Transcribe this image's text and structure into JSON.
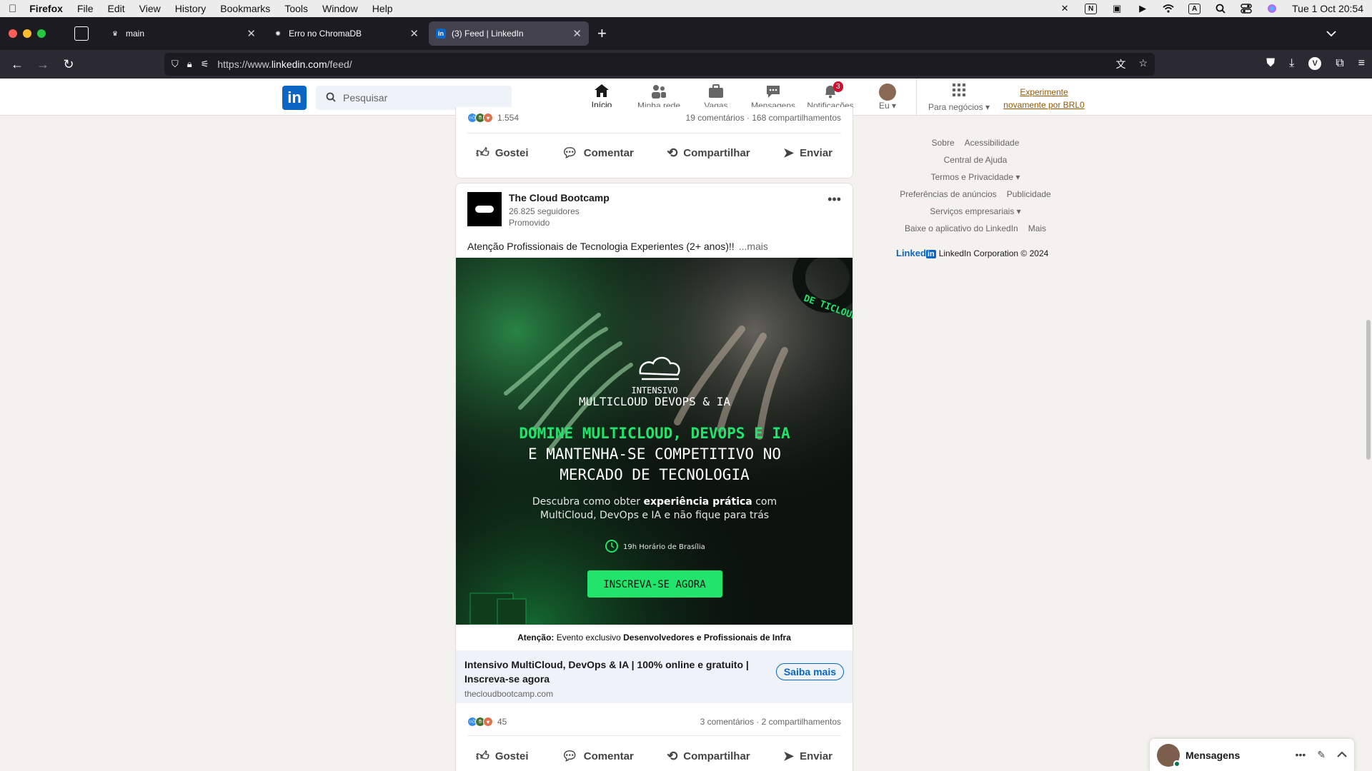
{
  "menubar": {
    "app": "Firefox",
    "items": [
      "File",
      "Edit",
      "View",
      "History",
      "Bookmarks",
      "Tools",
      "Window",
      "Help"
    ],
    "clock": "Tue 1 Oct  20:54"
  },
  "browser": {
    "tabs": [
      {
        "title": "main",
        "active": false
      },
      {
        "title": "Erro no ChromaDB",
        "active": false
      },
      {
        "title": "(3) Feed | LinkedIn",
        "active": true
      }
    ],
    "url_prefix": "https://www.",
    "url_domain": "linkedin.com",
    "url_path": "/feed/"
  },
  "linkedin_header": {
    "search_placeholder": "Pesquisar",
    "nav": [
      {
        "label": "Início",
        "icon": "home-icon",
        "active": true
      },
      {
        "label": "Minha rede",
        "icon": "network-icon",
        "active": false
      },
      {
        "label": "Vagas",
        "icon": "briefcase-icon",
        "active": false
      },
      {
        "label": "Mensagens",
        "icon": "chat-icon",
        "active": false
      },
      {
        "label": "Notificações",
        "icon": "bell-icon",
        "active": false,
        "badge": "3"
      },
      {
        "label": "Eu",
        "icon": "avatar",
        "active": false
      }
    ],
    "business": "Para negócios",
    "premium_line1": "Experimente",
    "premium_line2": "novamente por BRL0"
  },
  "prev_post": {
    "reaction_count": "1.554",
    "stats": "19 comentários · 168 compartilhamentos"
  },
  "actions": {
    "like": "Gostei",
    "comment": "Comentar",
    "share": "Compartilhar",
    "send": "Enviar"
  },
  "post": {
    "company": "The Cloud Bootcamp",
    "followers": "26.825 seguidores",
    "promoted": "Promovido",
    "text": "Atenção Profissionais de Tecnologia Experientes (2+ anos)!!",
    "more": "...mais",
    "ad": {
      "badge": "INTENSIVO",
      "product": "MULTICLOUD DEVOPS & IA",
      "headline_green": "DOMINE MULTICLOUD, DEVOPS E IA",
      "headline_white1": "E MANTENHA-SE COMPETITIVO NO",
      "headline_white2": "MERCADO DE TECNOLOGIA",
      "sub1_pre": "Descubra como obter ",
      "sub1_bold": "experiência prática",
      "sub1_post": " com",
      "sub2": "MultiCloud, DevOps e IA e não fique para trás",
      "time": "19h Horário de Brasília",
      "cta": "INSCREVA-SE AGORA",
      "ring_text": "DE  TICLOUD",
      "caption_bold1": "Atenção:",
      "caption_mid": " Evento exclusivo ",
      "caption_bold2": "Desenvolvedores e Profissionais de Infra"
    },
    "link_title": "Intensivo MultiCloud, DevOps & IA | 100% online e gratuito | Inscreva-se agora",
    "link_domain": "thecloudbootcamp.com",
    "link_button": "Saiba mais",
    "reaction_count": "45",
    "stats": "3 comentários · 2 compartilhamentos"
  },
  "footer": {
    "row1": [
      "Sobre",
      "Acessibilidade"
    ],
    "row2": [
      "Central de Ajuda"
    ],
    "row3": [
      "Termos e Privacidade"
    ],
    "row4": [
      "Preferências de anúncios",
      "Publicidade"
    ],
    "row5": [
      "Serviços empresariais"
    ],
    "row6": [
      "Baixe o aplicativo do LinkedIn",
      "Mais"
    ],
    "brand": "Linked",
    "brand_in": "in",
    "corp": "LinkedIn Corporation © 2024"
  },
  "messaging": {
    "title": "Mensagens"
  },
  "colors": {
    "linkedin_blue": "#0a66c2",
    "ad_green": "#22e36b"
  }
}
